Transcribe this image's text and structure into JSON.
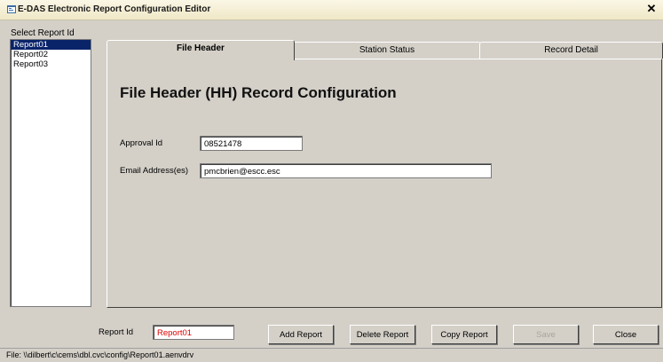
{
  "window": {
    "title": "E-DAS Electronic Report Configuration Editor",
    "close_glyph": "✕"
  },
  "report_list": {
    "label": "Select Report Id",
    "items": [
      "Report01",
      "Report02",
      "Report03"
    ],
    "selected_index": 0
  },
  "tabs": [
    {
      "label": "File Header",
      "active": true
    },
    {
      "label": "Station Status",
      "active": false
    },
    {
      "label": "Record Detail",
      "active": false
    }
  ],
  "file_header": {
    "title": "File Header (HH) Record Configuration",
    "approval_label": "Approval Id",
    "approval_value": "08521478",
    "email_label": "Email Address(es)",
    "email_value": "pmcbrien@escc.esc"
  },
  "footer": {
    "report_id_label": "Report Id",
    "report_id_value": "Report01",
    "report_id_color": "#e00000",
    "buttons": {
      "add": "Add Report",
      "delete": "Delete Report",
      "copy": "Copy Report",
      "save": "Save",
      "close": "Close"
    }
  },
  "status": {
    "file_path": "File:  \\\\dilbert\\c\\cems\\dbl.cvc\\config\\Report01.aenvdrv"
  },
  "colors": {
    "background": "#d4d0c8",
    "selection": "#0a246a"
  }
}
